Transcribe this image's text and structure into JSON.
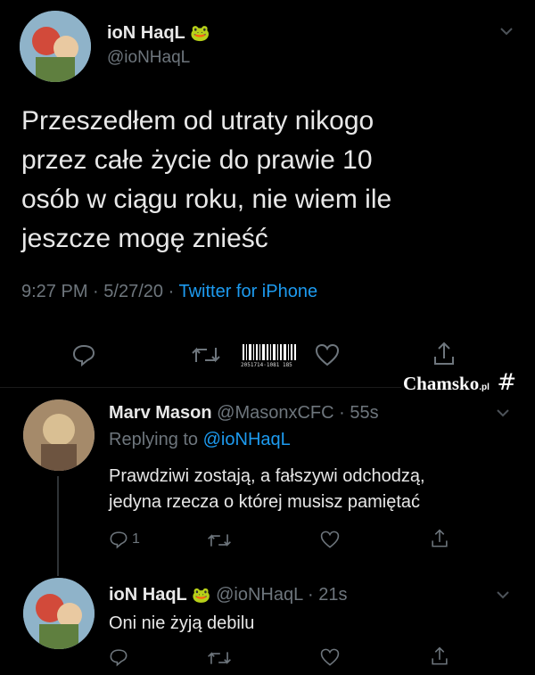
{
  "main_tweet": {
    "author_name": "ioN HaqL",
    "author_emoji": "🐸",
    "author_handle": "@ioNHaqL",
    "text_lines": [
      "Przeszedłem od utraty nikogo",
      "przez całe życie do prawie 10",
      "osób w ciągu roku, nie wiem ile",
      "jeszcze mogę znieść"
    ],
    "time": "9:27 PM",
    "date": "5/27/20",
    "source": "Twitter for iPhone",
    "barcode_text": "2051714·1081 185"
  },
  "watermark": {
    "brand": "Chamsko",
    "suffix": ".pl",
    "hash_symbol": "#"
  },
  "reply1": {
    "author_name": "Marv Mason",
    "author_handle": "@MasonxCFC",
    "time": "55s",
    "replying_label": "Replying to",
    "replying_handle": "@ioNHaqL",
    "text_lines": [
      "Prawdziwi zostają, a fałszywi odchodzą,",
      "jedyna rzecza o której musisz pamiętać"
    ],
    "reply_count": "1"
  },
  "reply2": {
    "author_name": "ioN HaqL",
    "author_emoji": "🐸",
    "author_handle": "@ioNHaqL",
    "time": "21s",
    "text": "Oni nie żyją debilu"
  },
  "separator": "·",
  "colors": {
    "background": "#000000",
    "link": "#1d9bf0",
    "muted": "#6e767d",
    "text": "#d9d9d9"
  }
}
